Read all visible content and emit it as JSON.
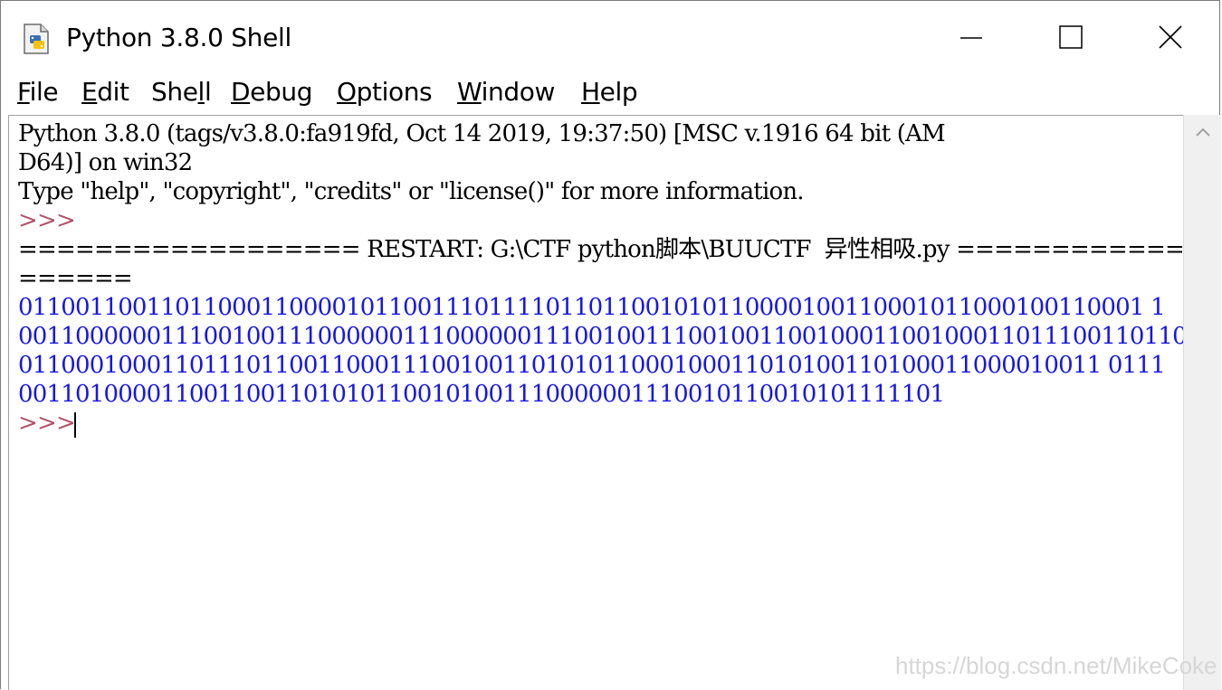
{
  "window": {
    "title": "Python 3.8.0 Shell",
    "icons": {
      "app": "python-shell-icon",
      "minimize": "minimize-icon",
      "maximize": "maximize-icon",
      "close": "close-icon"
    }
  },
  "menu": {
    "file": {
      "acc": "F",
      "rest": "ile"
    },
    "edit": {
      "acc": "E",
      "rest": "dit"
    },
    "shell": {
      "pre": "She",
      "acc": "l",
      "rest": "l"
    },
    "debug": {
      "acc": "D",
      "rest": "ebug"
    },
    "options": {
      "acc": "O",
      "rest": "ptions"
    },
    "window": {
      "acc": "W",
      "rest": "indow"
    },
    "help": {
      "acc": "H",
      "rest": "elp"
    }
  },
  "shell": {
    "banner_line1": "Python 3.8.0 (tags/v3.8.0:fa919fd, Oct 14 2019, 19:37:50) [MSC v.1916 64 bit (AM",
    "banner_line2": "D64)] on win32",
    "banner_line3": "Type \"help\", \"copyright\", \"credits\" or \"license()\" for more information.",
    "prompt": ">>>",
    "restart_line1": "================== RESTART: G:\\CTF python脚本\\BUUCTF  异性相吸.py ============",
    "restart_line2": "======",
    "output_line1": "0110011001101100011000010110011101111011011001010110000100110001011000100110001 1",
    "output_line2": "0011000000111001001110000001110000001110010011100100110010001100100011011100110110",
    "output_line3": "0110001000110111011001100011100100110101011000100011010100110100011000010011 0111",
    "output_line4": "00110100001100110011010101100101001110000001110010110010101111101",
    "final_prompt": ">>>"
  },
  "scrollbar": {
    "up_icon": "scroll-up-arrow-icon"
  },
  "watermark": "https://blog.csdn.net/MikeCoke"
}
